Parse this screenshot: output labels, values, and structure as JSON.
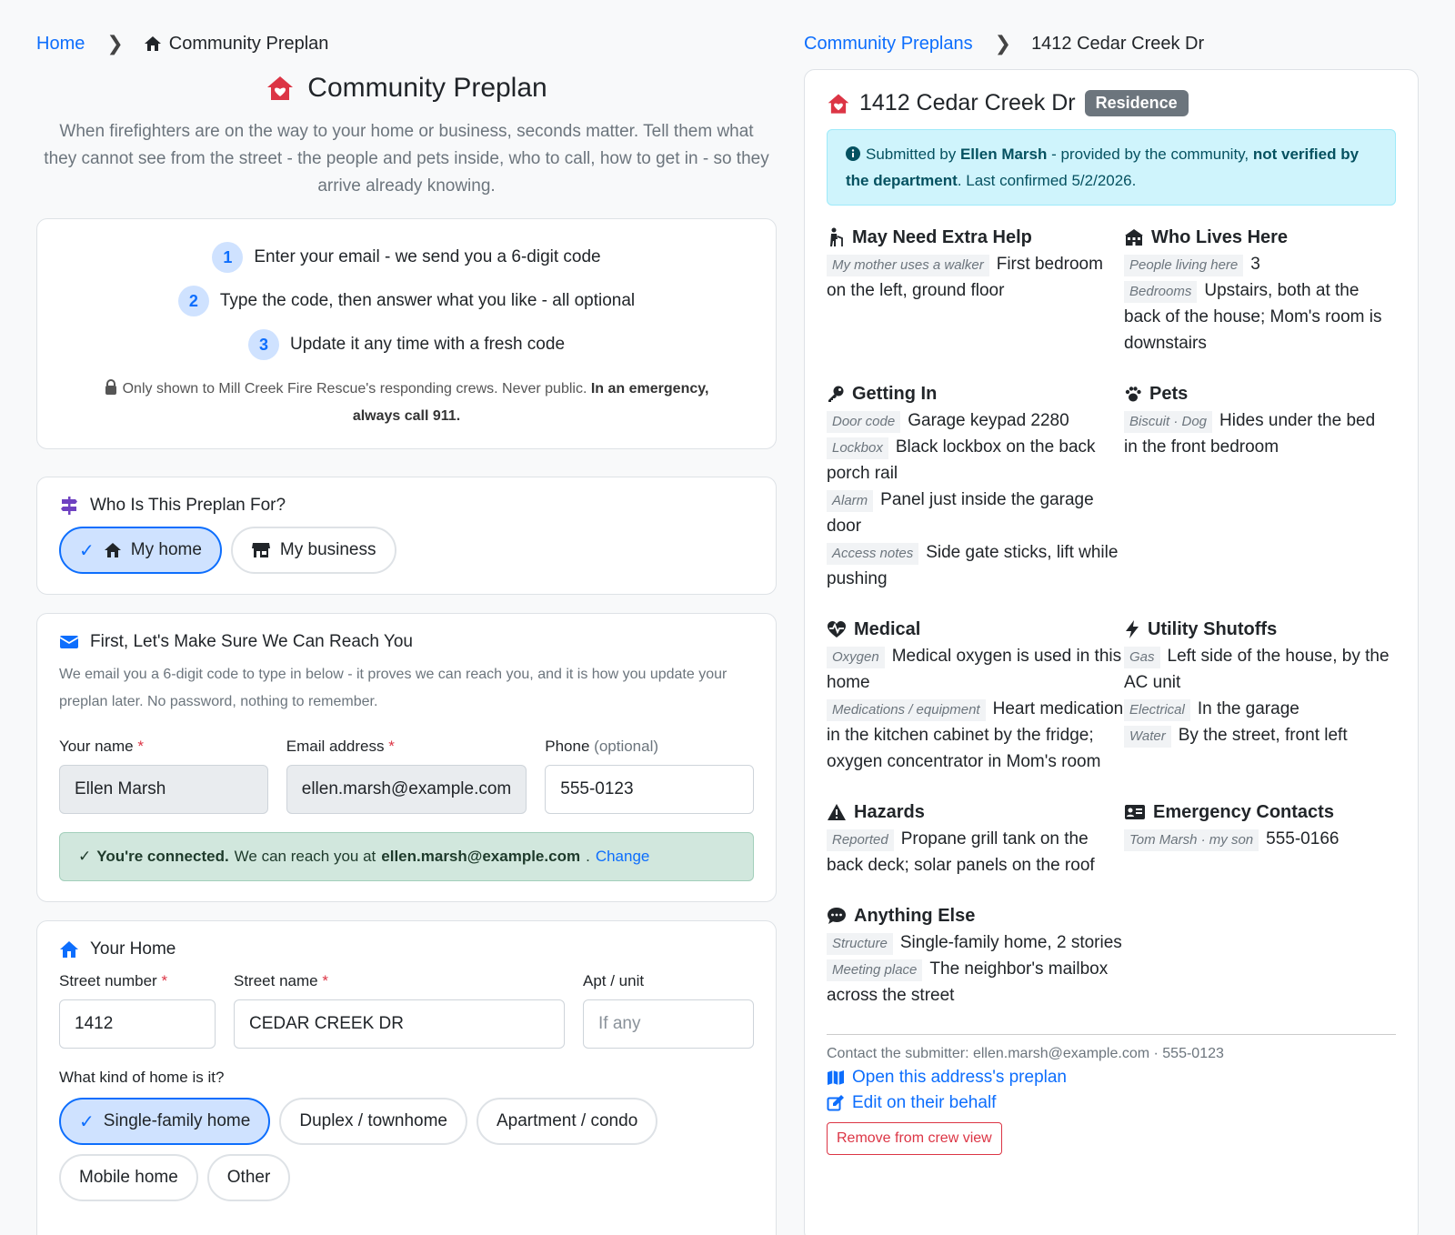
{
  "left": {
    "breadcrumb": {
      "home": "Home",
      "current": "Community Preplan"
    },
    "title": "Community Preplan",
    "intro": "When firefighters are on the way to your home or business, seconds matter. Tell them what they cannot see from the street - the people and pets inside, who to call, how to get in - so they arrive already knowing.",
    "steps": [
      {
        "num": "1",
        "text": "Enter your email - we send you a 6-digit code"
      },
      {
        "num": "2",
        "text": "Type the code, then answer what you like - all optional"
      },
      {
        "num": "3",
        "text": "Update it any time with a fresh code"
      }
    ],
    "privacy": {
      "text": "Only shown to Mill Creek Fire Rescue's responding crews. Never public.",
      "bold": "In an emergency, always call 911."
    },
    "who": {
      "title": "Who Is This Preplan For?",
      "options": [
        "My home",
        "My business"
      ],
      "selected": "My home"
    },
    "reach": {
      "title": "First, Let's Make Sure We Can Reach You",
      "desc": "We email you a 6-digit code to type in below - it proves we can reach you, and it is how you update your preplan later. No password, nothing to remember.",
      "name_label": "Your name",
      "email_label": "Email address",
      "phone_label": "Phone",
      "phone_opt": "(optional)",
      "name_value": "Ellen Marsh",
      "email_value": "ellen.marsh@example.com",
      "phone_value": "555-0123",
      "connected_bold": "You're connected.",
      "connected_text": "We can reach you at",
      "connected_email": "ellen.marsh@example.com",
      "change": "Change"
    },
    "home": {
      "title": "Your Home",
      "street_number_label": "Street number",
      "street_name_label": "Street name",
      "apt_label": "Apt / unit",
      "street_number": "1412",
      "street_name": "CEDAR CREEK DR",
      "apt_placeholder": "If any",
      "kind_label": "What kind of home is it?",
      "kinds": [
        "Single-family home",
        "Duplex / townhome",
        "Apartment / condo",
        "Mobile home",
        "Other"
      ],
      "kind_selected": "Single-family home"
    }
  },
  "right": {
    "breadcrumb": {
      "parent": "Community Preplans",
      "current": "1412 Cedar Creek Dr"
    },
    "address": "1412 Cedar Creek Dr",
    "badge": "Residence",
    "info": {
      "pre": "Submitted by",
      "name": "Ellen Marsh",
      "mid": "- provided by the community,",
      "bold": "not verified by the department",
      "post": ". Last confirmed 5/2/2026."
    },
    "extra_help": {
      "title": "May Need Extra Help",
      "tag": "My mother uses a walker",
      "text": "First bedroom on the left, ground floor"
    },
    "who_lives": {
      "title": "Who Lives Here",
      "items": [
        {
          "tag": "People living here",
          "text": "3"
        },
        {
          "tag": "Bedrooms",
          "text": "Upstairs, both at the back of the house; Mom's room is downstairs"
        }
      ]
    },
    "getting_in": {
      "title": "Getting In",
      "items": [
        {
          "tag": "Door code",
          "text": "Garage keypad 2280"
        },
        {
          "tag": "Lockbox",
          "text": "Black lockbox on the back porch rail"
        },
        {
          "tag": "Alarm",
          "text": "Panel just inside the garage door"
        },
        {
          "tag": "Access notes",
          "text": "Side gate sticks, lift while pushing"
        }
      ]
    },
    "pets": {
      "title": "Pets",
      "items": [
        {
          "tag": "Biscuit · Dog",
          "text": "Hides under the bed in the front bedroom"
        }
      ]
    },
    "medical": {
      "title": "Medical",
      "items": [
        {
          "tag": "Oxygen",
          "text": "Medical oxygen is used in this home"
        },
        {
          "tag": "Medications / equipment",
          "text": "Heart medication in the kitchen cabinet by the fridge; oxygen concentrator in Mom's room"
        }
      ]
    },
    "utility": {
      "title": "Utility Shutoffs",
      "items": [
        {
          "tag": "Gas",
          "text": "Left side of the house, by the AC unit"
        },
        {
          "tag": "Electrical",
          "text": "In the garage"
        },
        {
          "tag": "Water",
          "text": "By the street, front left"
        }
      ]
    },
    "hazards": {
      "title": "Hazards",
      "items": [
        {
          "tag": "Reported",
          "text": "Propane grill tank on the back deck; solar panels on the roof"
        }
      ]
    },
    "contacts": {
      "title": "Emergency Contacts",
      "items": [
        {
          "tag": "Tom Marsh · my son",
          "text": "555-0166"
        }
      ]
    },
    "anything": {
      "title": "Anything Else",
      "items": [
        {
          "tag": "Structure",
          "text": "Single-family home, 2 stories"
        },
        {
          "tag": "Meeting place",
          "text": "The neighbor's mailbox across the street"
        }
      ]
    },
    "footer": {
      "contact": "Contact the submitter: ellen.marsh@example.com · 555-0123",
      "open_link": "Open this address's preplan",
      "edit_link": "Edit on their behalf",
      "remove": "Remove from crew view"
    }
  },
  "colors": {
    "primary": "#0d6efd",
    "danger": "#dc3545",
    "brand_red": "#dc3545",
    "purple": "#6f42c1",
    "success_bg": "#d1e7dd",
    "info_bg": "#cff4fc",
    "badge": "#6c757d"
  }
}
